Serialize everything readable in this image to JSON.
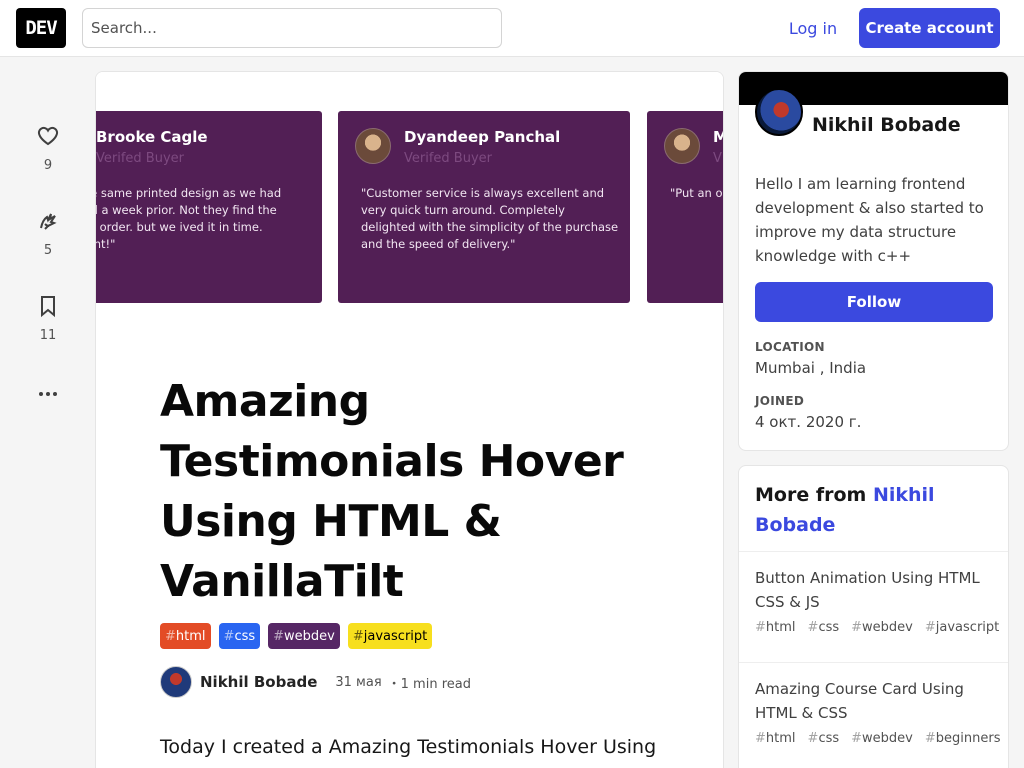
{
  "header": {
    "logo": "DEV",
    "search_placeholder": "Search...",
    "login_label": "Log in",
    "create_account_label": "Create account"
  },
  "actions": {
    "reactions_count": "9",
    "unicorns_count": "5",
    "bookmarks_count": "11"
  },
  "cover": {
    "testimonials": [
      {
        "name": "Brooke Cagle",
        "subtitle": "Verifed Buyer",
        "quote": "ded the same printed design as we had ordered a week prior. Not they find the original order. but we ived it in time. Excellent!\""
      },
      {
        "name": "Dyandeep Panchal",
        "subtitle": "Verifed Buyer",
        "quote": "\"Customer service is always excellent and very quick turn around. Completely delighted with the simplicity of the purchase and the speed of delivery.\""
      },
      {
        "name": "M",
        "subtitle": "V",
        "quote": "\"Put an or only prais standatd. and recon"
      }
    ]
  },
  "article": {
    "title": "Amazing Testimonials Hover Using HTML & VanillaTilt",
    "tags": [
      {
        "hash": "#",
        "name": "html"
      },
      {
        "hash": "#",
        "name": "css"
      },
      {
        "hash": "#",
        "name": "webdev"
      },
      {
        "hash": "#",
        "name": "javascript"
      }
    ],
    "author": "Nikhil Bobade",
    "date": "31 мая",
    "read_time": "・1 min read",
    "intro": "Today I created a Amazing Testimonials Hover Using"
  },
  "sidebar": {
    "profile": {
      "name": "Nikhil Bobade",
      "bio": "Hello I am learning frontend development & also started to improve my data structure knowledge with c++",
      "follow_label": "Follow",
      "location_label": "LOCATION",
      "location": "Mumbai , India",
      "joined_label": "JOINED",
      "joined": "4 окт. 2020 г."
    },
    "more": {
      "heading_prefix": "More from ",
      "heading_link": "Nikhil Bobade",
      "items": [
        {
          "title": "Button Animation Using HTML CSS & JS",
          "tags": [
            "html",
            "css",
            "webdev",
            "javascript"
          ]
        },
        {
          "title": "Amazing Course Card Using HTML & CSS",
          "tags": [
            "html",
            "css",
            "webdev",
            "beginners"
          ]
        }
      ]
    }
  },
  "colors": {
    "accent": "#3b49df",
    "testimonial_card": "#521f55",
    "tag_html": "#e34c26",
    "tag_css": "#2965f1",
    "tag_webdev": "#562765",
    "tag_javascript": "#f7df1e"
  }
}
